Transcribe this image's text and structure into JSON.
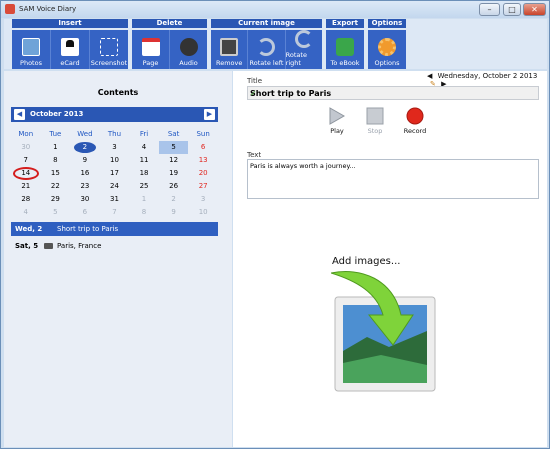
{
  "window": {
    "title": "SAM Voice Diary",
    "min": "–",
    "max": "□",
    "close": "✕"
  },
  "ribbon": {
    "insert": {
      "label": "Insert",
      "buttons": [
        "Photos",
        "eCard",
        "Screenshot"
      ]
    },
    "delete": {
      "label": "Delete",
      "buttons": [
        "Page",
        "Audio"
      ]
    },
    "current_image": {
      "label": "Current image",
      "buttons": [
        "Remove",
        "Rotate left",
        "Rotate right"
      ]
    },
    "export": {
      "label": "Export",
      "buttons": [
        "To eBook"
      ]
    },
    "options": {
      "label": "Options",
      "buttons": [
        "Options"
      ]
    }
  },
  "left": {
    "heading": "Contents",
    "calendar": {
      "month": "October 2013",
      "prev": "◀",
      "next": "▶",
      "days": [
        "Mon",
        "Tue",
        "Wed",
        "Thu",
        "Fri",
        "Sat",
        "Sun"
      ],
      "weeks": [
        [
          "30",
          "1",
          "2",
          "3",
          "4",
          "5",
          "6"
        ],
        [
          "7",
          "8",
          "9",
          "10",
          "11",
          "12",
          "13"
        ],
        [
          "14",
          "15",
          "16",
          "17",
          "18",
          "19",
          "20"
        ],
        [
          "21",
          "22",
          "23",
          "24",
          "25",
          "26",
          "27"
        ],
        [
          "28",
          "29",
          "30",
          "31",
          "1",
          "2",
          "3"
        ],
        [
          "4",
          "5",
          "6",
          "7",
          "8",
          "9",
          "10"
        ]
      ]
    },
    "entries": [
      {
        "date": "Wed, 2",
        "text": "Short trip to Paris"
      },
      {
        "date": "Sat, 5",
        "text": "Paris, France"
      }
    ]
  },
  "right": {
    "title_label": "Title",
    "date": "Wednesday, October 2 2013",
    "date_prev": "◀",
    "date_next": "▶",
    "title_value": "Short trip to Paris",
    "check": "✓",
    "media": {
      "play": "Play",
      "stop": "Stop",
      "record": "Record"
    },
    "text_label": "Text",
    "text_value": "Paris is always worth a journey...",
    "add_images": "Add images..."
  },
  "colors": {
    "accent": "#2a57b4",
    "button_blue": "#3563c4",
    "today_ring": "#d41d1d",
    "weekend_red": "#e1261f"
  }
}
